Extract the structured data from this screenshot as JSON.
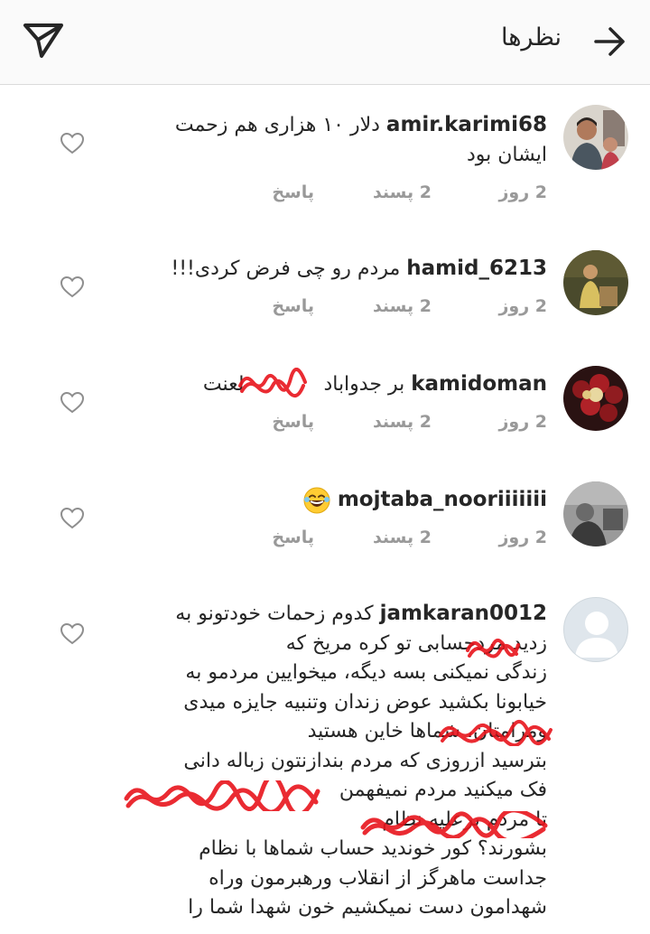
{
  "header": {
    "title": "نظرها",
    "send_icon": "send-paper-plane-icon",
    "back_icon": "arrow-right-icon"
  },
  "comments": [
    {
      "username": "amir.karimi68",
      "text": "دلار ۱۰ هزاری هم زحمت ایشان بود",
      "time": "2 روز",
      "likes": "2 پسند",
      "reply": "پاسخ"
    },
    {
      "username": "hamid_6213",
      "text": "مردم رو چی فرض کردی!!!",
      "time": "2 روز",
      "likes": "2 پسند",
      "reply": "پاسخ"
    },
    {
      "username": "kamidoman",
      "text_before": "بر جدواباد",
      "text_after": "لعنت",
      "time": "2 روز",
      "likes": "2 پسند",
      "reply": "پاسخ"
    },
    {
      "username": "mojtaba_nooriiiiiii",
      "emoji": "laughing-face-emoji",
      "time": "2 روز",
      "likes": "2 پسند",
      "reply": "پاسخ"
    },
    {
      "username": "jamkaran0012",
      "lines": [
        "کدوم زحمات خودتونو به",
        "زدید مردحسابی تو کره مریخ که",
        "زندگی نمیکنی بسه دیگه، میخوایین مردمو به",
        "خیابونا بکشید عوض زندان وتنبیه جایزه میدی",
        "ومرامتان، شماها خاین هستید",
        "بترسید ازروزی که مردم بندازنتون زباله دانی",
        "فک میکنید مردم نمیفهمن",
        "تا مردم برعلیه نظام",
        "بشورند؟ کور خوندید حساب شماها با نظام",
        "جداست ماهرگز از انقلاب ورهبرمون وراه",
        "شهدامون دست نمیکشیم خون شهدا شما را"
      ]
    }
  ],
  "colors": {
    "meta_gray": "#999999",
    "scribble_red": "#e8141c",
    "header_bg": "#fafafa"
  }
}
